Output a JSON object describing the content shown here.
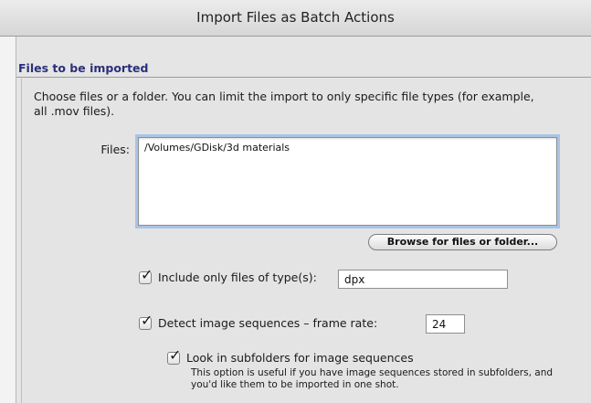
{
  "window": {
    "title": "Import Files as Batch Actions"
  },
  "section": {
    "title": "Files to be imported",
    "description": "Choose files or a folder. You can limit the import to only specific file types (for example, all .mov files)."
  },
  "files": {
    "label": "Files:",
    "value": "/Volumes/GDisk/3d materials"
  },
  "browse_button": {
    "label": "Browse for files or folder..."
  },
  "include_types": {
    "checked": true,
    "label": "Include only files of type(s):",
    "value": "dpx"
  },
  "detect_sequences": {
    "checked": true,
    "label": "Detect image sequences – frame rate:",
    "value": "24"
  },
  "subfolders": {
    "checked": true,
    "label": "Look in subfolders for image sequences",
    "help": "This option is useful if you have image sequences stored in subfolders, and you'd like them to be imported in one shot."
  }
}
